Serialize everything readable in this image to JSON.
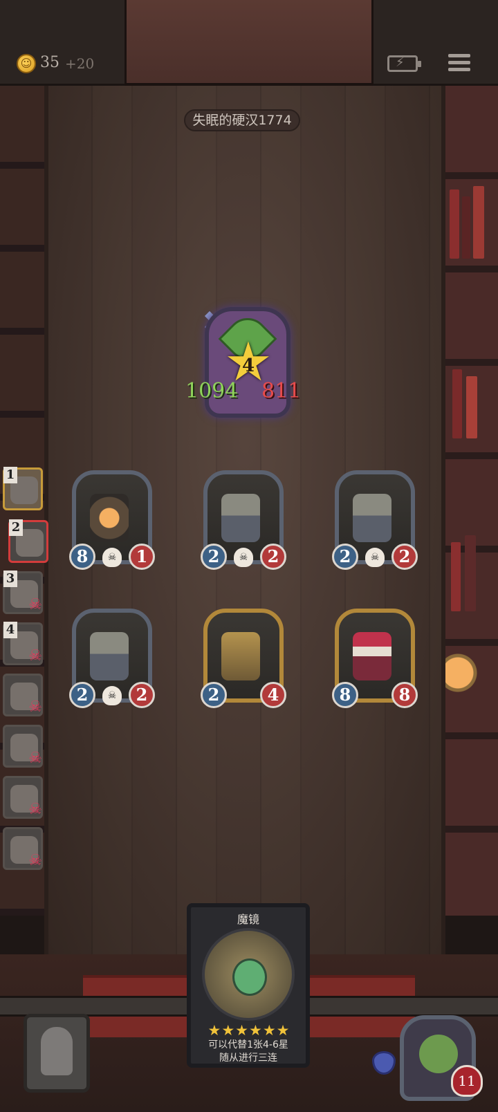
{
  "header": {
    "coin_icon": "coin-icon",
    "coins": "35",
    "coin_income": "+20",
    "battery_icon": "battery-icon",
    "menu_icon": "menu-icon"
  },
  "opponent": {
    "name": "失眠的硬汉1774",
    "hero_level": "4",
    "hero_attack": "1094",
    "hero_health": "811"
  },
  "board": {
    "row1": [
      {
        "name": "lantern-minion",
        "attack": "8",
        "health": "1",
        "gold": false
      },
      {
        "name": "bell-robot-minion",
        "attack": "2",
        "health": "2",
        "gold": false
      },
      {
        "name": "bell-robot-minion",
        "attack": "2",
        "health": "2",
        "gold": false
      }
    ],
    "row2": [
      {
        "name": "bell-robot-minion",
        "attack": "2",
        "health": "2",
        "gold": false
      },
      {
        "name": "antenna-robot-minion",
        "attack": "2",
        "health": "4",
        "gold": true
      },
      {
        "name": "jester-minion",
        "attack": "8",
        "health": "8",
        "gold": true
      }
    ]
  },
  "ranks": [
    {
      "num": "1",
      "state": "me"
    },
    {
      "num": "2",
      "state": "opponent"
    },
    {
      "num": "3",
      "state": "dead"
    },
    {
      "num": "4",
      "state": "dead"
    },
    {
      "num": "",
      "state": "dead"
    },
    {
      "num": "",
      "state": "dead"
    },
    {
      "num": "",
      "state": "dead"
    },
    {
      "num": "",
      "state": "dead"
    }
  ],
  "card": {
    "title": "魔镜",
    "stars": "★★★★★★",
    "desc_line1": "可以代替1张4-6星",
    "desc_line2": "随从进行三连"
  },
  "player": {
    "health": "11",
    "shield_icon": "shield-icon"
  },
  "colors": {
    "attack_badge": "#3d6186",
    "health_badge": "#b23a3a",
    "gold_frame": "#b2883a"
  }
}
